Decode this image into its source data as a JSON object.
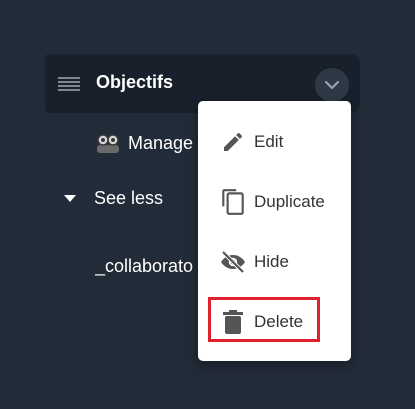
{
  "sidebar": {
    "active_item": {
      "label": "Objectifs"
    },
    "sub_item": {
      "label": "Manage"
    },
    "toggle": {
      "label": "See less"
    },
    "collab_item": {
      "label": "_collaborato"
    }
  },
  "context_menu": {
    "items": [
      {
        "label": "Edit",
        "icon": "pencil-icon"
      },
      {
        "label": "Duplicate",
        "icon": "copy-icon"
      },
      {
        "label": "Hide",
        "icon": "eye-off-icon"
      },
      {
        "label": "Delete",
        "icon": "trash-icon",
        "highlighted": true
      }
    ],
    "highlight_color": "#e0212e"
  },
  "colors": {
    "background": "#222b38",
    "active_item_bg": "#18202b",
    "menu_bg": "#ffffff",
    "menu_text": "#333333"
  }
}
